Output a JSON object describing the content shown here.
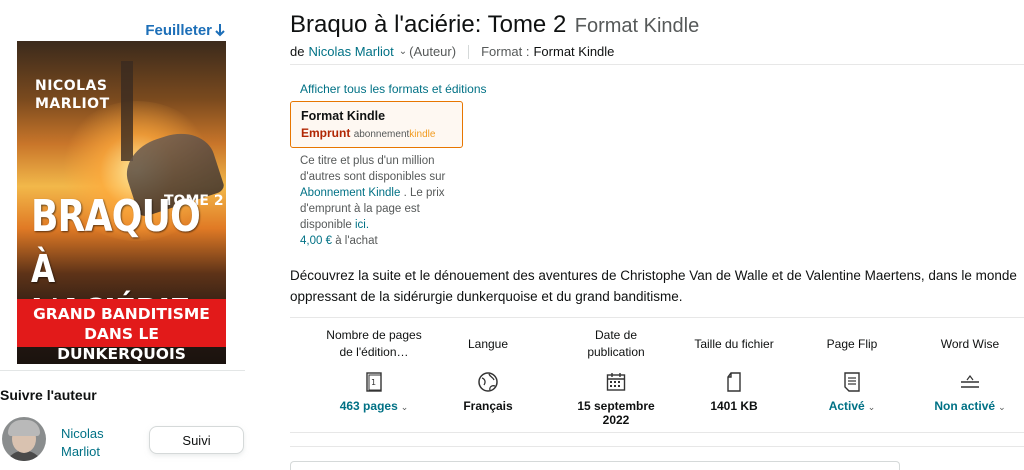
{
  "preview": {
    "label": "Feuilleter"
  },
  "cover": {
    "author_line1": "NICOLAS",
    "author_line2": "MARLIOT",
    "tome": "TOME 2",
    "title_line1": "BRAQUO",
    "title_line2": "À L'ACIÉRIE",
    "banner_line1": "GRAND BANDITISME",
    "banner_line2": "DANS LE DUNKERQUOIS"
  },
  "follow": {
    "title": "Suivre l'auteur",
    "author_first": "Nicolas",
    "author_last": "Marliot",
    "button": "Suivi"
  },
  "product": {
    "title": "Braquo à l'aciérie: Tome 2",
    "format_suffix": "Format Kindle",
    "by": "de",
    "author": "Nicolas Marliot",
    "role": "(Auteur)",
    "format_label": "Format :",
    "format_value": "Format Kindle"
  },
  "formats": {
    "all_link": "Afficher tous les formats et éditions",
    "swatch_title": "Format Kindle",
    "swatch_emprunt": "Emprunt",
    "swatch_abo": "abonnement",
    "swatch_kindle": "kindle",
    "note_1": "Ce titre et plus d'un million d'autres sont disponibles sur",
    "note_link_ku": "Abonnement Kindle",
    "note_2": ". Le prix d'emprunt à la page est disponible",
    "note_link_ici": "ici.",
    "price": "4,00 €",
    "price_suffix": "à l'achat"
  },
  "description": "Découvrez la suite et le dénouement des aventures de Christophe Van de Walle et de Valentine Maertens, dans le monde oppressant de la sidérurgie dunkerquoise et du grand banditisme.",
  "attributes": [
    {
      "label": "Nombre de pages de l'édition…",
      "icon": "book-pages-icon",
      "value": "463 pages"
    },
    {
      "label": "Langue",
      "icon": "globe-icon",
      "value": "Français"
    },
    {
      "label": "Date de publication",
      "icon": "calendar-icon",
      "value": "15 septembre 2022"
    },
    {
      "label": "Taille du fichier",
      "icon": "file-icon",
      "value": "1401 KB"
    },
    {
      "label": "Page Flip",
      "icon": "page-flip-icon",
      "value": "Activé"
    },
    {
      "label": "Word Wise",
      "icon": "word-wise-icon",
      "value": "Non activé"
    }
  ],
  "colors": {
    "link": "#007185",
    "emprunt": "#b12704",
    "swatch_border": "#e77600",
    "preview_link": "#1d6fb8",
    "cover_banner": "#e21a1a"
  }
}
